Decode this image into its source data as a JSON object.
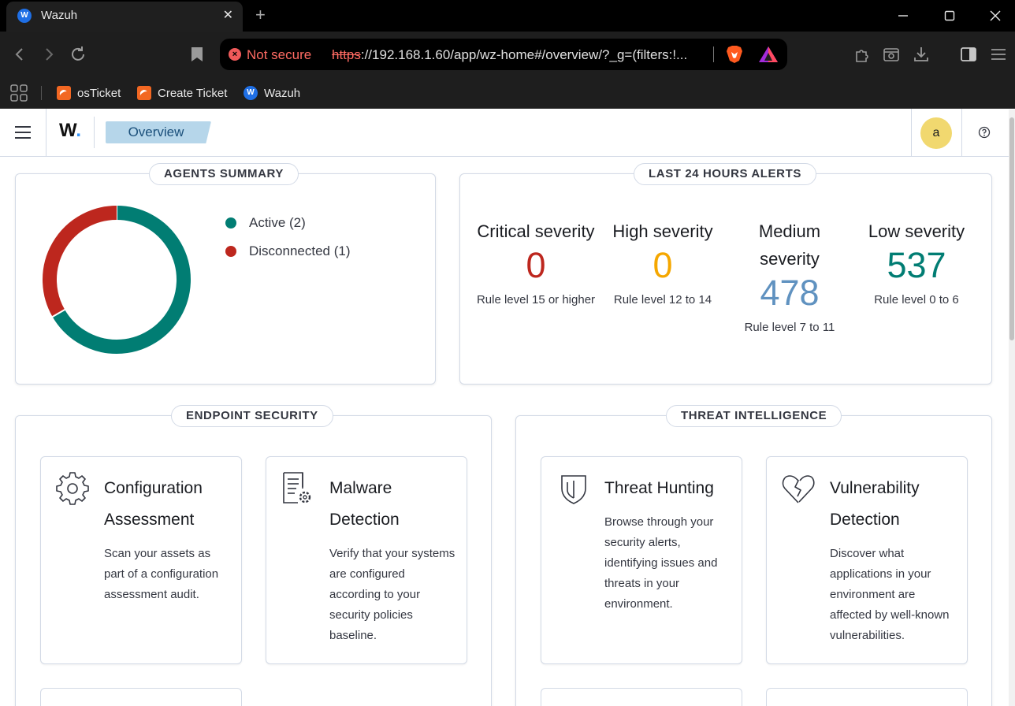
{
  "browser": {
    "tab_title": "Wazuh",
    "tab_favicon_letter": "W",
    "not_secure_label": "Not secure",
    "url_scheme": "https",
    "url_rest": "://192.168.1.60/app/wz-home#/overview/?_g=(filters:!...",
    "bookmarks": [
      {
        "label": "osTicket",
        "icon": "osticket-icon"
      },
      {
        "label": "Create Ticket",
        "icon": "osticket-icon"
      },
      {
        "label": "Wazuh",
        "icon": "wazuh-icon"
      }
    ]
  },
  "header": {
    "logo_text": "W",
    "logo_dot": ".",
    "breadcrumb": "Overview",
    "avatar_initial": "a"
  },
  "agents_summary": {
    "title": "AGENTS SUMMARY",
    "legend": [
      {
        "label": "Active (2)",
        "color": "#017d73"
      },
      {
        "label": "Disconnected (1)",
        "color": "#bd271e"
      }
    ]
  },
  "chart_data": {
    "type": "pie",
    "title": "AGENTS SUMMARY",
    "donut": true,
    "categories": [
      "Active",
      "Disconnected"
    ],
    "values": [
      2,
      1
    ],
    "colors": [
      "#017d73",
      "#bd271e"
    ]
  },
  "alerts": {
    "title": "LAST 24 HOURS ALERTS",
    "items": [
      {
        "title": "Critical severity",
        "value": "0",
        "sub": "Rule level 15 or higher",
        "color": "#bd271e"
      },
      {
        "title": "High severity",
        "value": "0",
        "sub": "Rule level 12 to 14",
        "color": "#f5a700"
      },
      {
        "title": "Medium severity",
        "value": "478",
        "sub": "Rule level 7 to 11",
        "color": "#6092c0"
      },
      {
        "title": "Low severity",
        "value": "537",
        "sub": "Rule level 0 to 6",
        "color": "#017d73"
      }
    ]
  },
  "endpoint": {
    "title": "ENDPOINT SECURITY",
    "cards": [
      {
        "title": "Configuration Assessment",
        "desc": "Scan your assets as part of a configuration assessment audit.",
        "icon": "gear-icon"
      },
      {
        "title": "Malware Detection",
        "desc": "Verify that your systems are configured according to your security policies baseline.",
        "icon": "document-gear-icon"
      }
    ]
  },
  "threat": {
    "title": "THREAT INTELLIGENCE",
    "cards": [
      {
        "title": "Threat Hunting",
        "desc": "Browse through your security alerts, identifying issues and threats in your environment.",
        "icon": "shield-icon"
      },
      {
        "title": "Vulnerability Detection",
        "desc": "Discover what applications in your environment are affected by well-known vulnerabilities.",
        "icon": "broken-heart-icon"
      }
    ]
  }
}
